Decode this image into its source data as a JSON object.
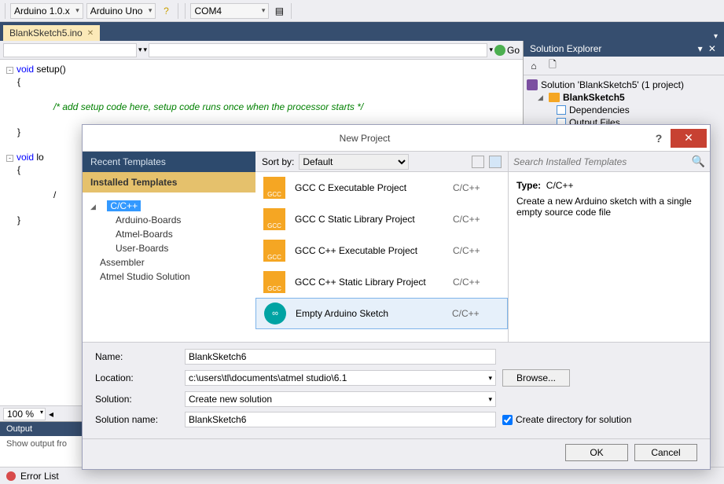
{
  "toolbar": {
    "arduino_ver": "Arduino 1.0.x",
    "board": "Arduino Uno",
    "port": "COM4"
  },
  "tab": {
    "name": "BlankSketch5.ino"
  },
  "editor_toolbar": {
    "go": "Go"
  },
  "code": {
    "l1a": "void",
    "l1b": " setup()",
    "l2": "{",
    "l3": "/* add setup code here, setup code runs once when the processor starts */",
    "l4": "}",
    "l5a": "void",
    "l5b": " lo",
    "l6": "{",
    "l7": "/",
    "l8": "}"
  },
  "zoom": {
    "value": "100 %"
  },
  "output": {
    "title": "Output",
    "label": "Show output fro"
  },
  "solution_explorer": {
    "title": "Solution Explorer",
    "root": "Solution 'BlankSketch5' (1 project)",
    "project": "BlankSketch5",
    "deps": "Dependencies",
    "outfiles": "Output Files"
  },
  "error_list": "Error List",
  "dialog": {
    "title": "New Project",
    "left": {
      "recent": "Recent Templates",
      "installed": "Installed Templates",
      "cpp": "C/C++",
      "ab": "Arduino-Boards",
      "atb": "Atmel-Boards",
      "ub": "User-Boards",
      "asm": "Assembler",
      "ass": "Atmel Studio Solution"
    },
    "sort_label": "Sort by:",
    "sort_value": "Default",
    "templates": [
      {
        "name": "GCC C Executable Project",
        "type": "C/C++",
        "icon": "gcc"
      },
      {
        "name": "GCC C Static Library Project",
        "type": "C/C++",
        "icon": "gcc"
      },
      {
        "name": "GCC C++ Executable Project",
        "type": "C/C++",
        "icon": "gcc"
      },
      {
        "name": "GCC C++ Static Library Project",
        "type": "C/C++",
        "icon": "gcc"
      },
      {
        "name": "Empty Arduino Sketch",
        "type": "C/C++",
        "icon": "ard"
      }
    ],
    "search_placeholder": "Search Installed Templates",
    "desc_type_label": "Type:",
    "desc_type": "C/C++",
    "desc": "Create a new Arduino sketch with a single empty source code file",
    "name_label": "Name:",
    "name_value": "BlankSketch6",
    "loc_label": "Location:",
    "loc_value": "c:\\users\\tl\\documents\\atmel studio\\6.1",
    "sol_label": "Solution:",
    "sol_value": "Create new solution",
    "solname_label": "Solution name:",
    "solname_value": "BlankSketch6",
    "browse": "Browse...",
    "chk_label": "Create directory for solution",
    "ok": "OK",
    "cancel": "Cancel"
  }
}
